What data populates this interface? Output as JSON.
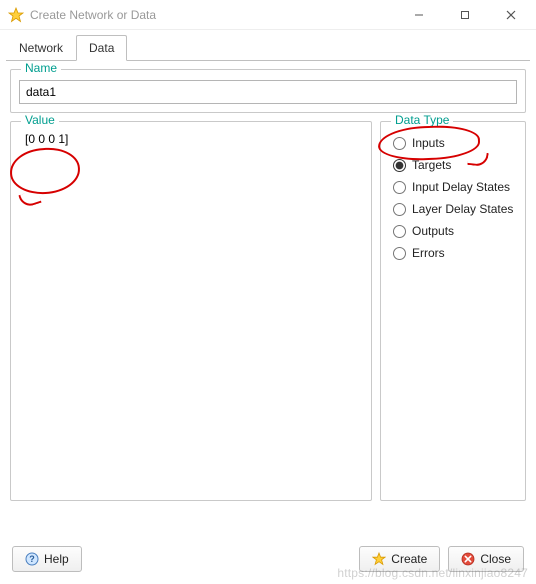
{
  "window": {
    "title": "Create Network or Data",
    "minimize_tooltip": "Minimize",
    "maximize_tooltip": "Maximize",
    "close_tooltip": "Close"
  },
  "tabs": [
    {
      "label": "Network",
      "active": false
    },
    {
      "label": "Data",
      "active": true
    }
  ],
  "groups": {
    "name": {
      "legend": "Name",
      "value": "data1"
    },
    "value": {
      "legend": "Value",
      "content": "[0 0 0 1]"
    },
    "datatype": {
      "legend": "Data Type",
      "options": [
        {
          "label": "Inputs",
          "selected": false
        },
        {
          "label": "Targets",
          "selected": true
        },
        {
          "label": "Input Delay States",
          "selected": false
        },
        {
          "label": "Layer Delay States",
          "selected": false
        },
        {
          "label": "Outputs",
          "selected": false
        },
        {
          "label": "Errors",
          "selected": false
        }
      ]
    }
  },
  "buttons": {
    "help": "Help",
    "create": "Create",
    "close": "Close"
  },
  "colors": {
    "accent_legend": "#009e8f",
    "annotation": "#d60000"
  },
  "watermark": "https://blog.csdn.net/linxinjiao8247"
}
